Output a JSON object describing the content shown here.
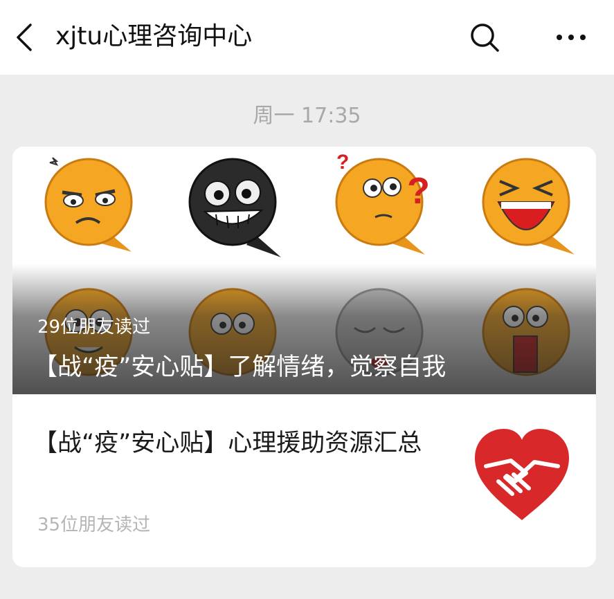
{
  "header": {
    "title": "xjtu心理咨询中心"
  },
  "timestamp": "周一 17:35",
  "cover_article": {
    "reads": "29位朋友读过",
    "title": "【战“疫”安心贴】了解情绪，觉察自我"
  },
  "articles": [
    {
      "title": "【战“疫”安心贴】心理援助资源汇总",
      "reads": "35位朋友读过"
    }
  ],
  "colors": {
    "header_bg": "#ffffff",
    "page_bg": "#ededed",
    "heart_red": "#d8282a",
    "emoji_orange": "#f5a623"
  },
  "icons": [
    "back-icon",
    "search-icon",
    "more-icon",
    "heart-handshake-icon"
  ]
}
